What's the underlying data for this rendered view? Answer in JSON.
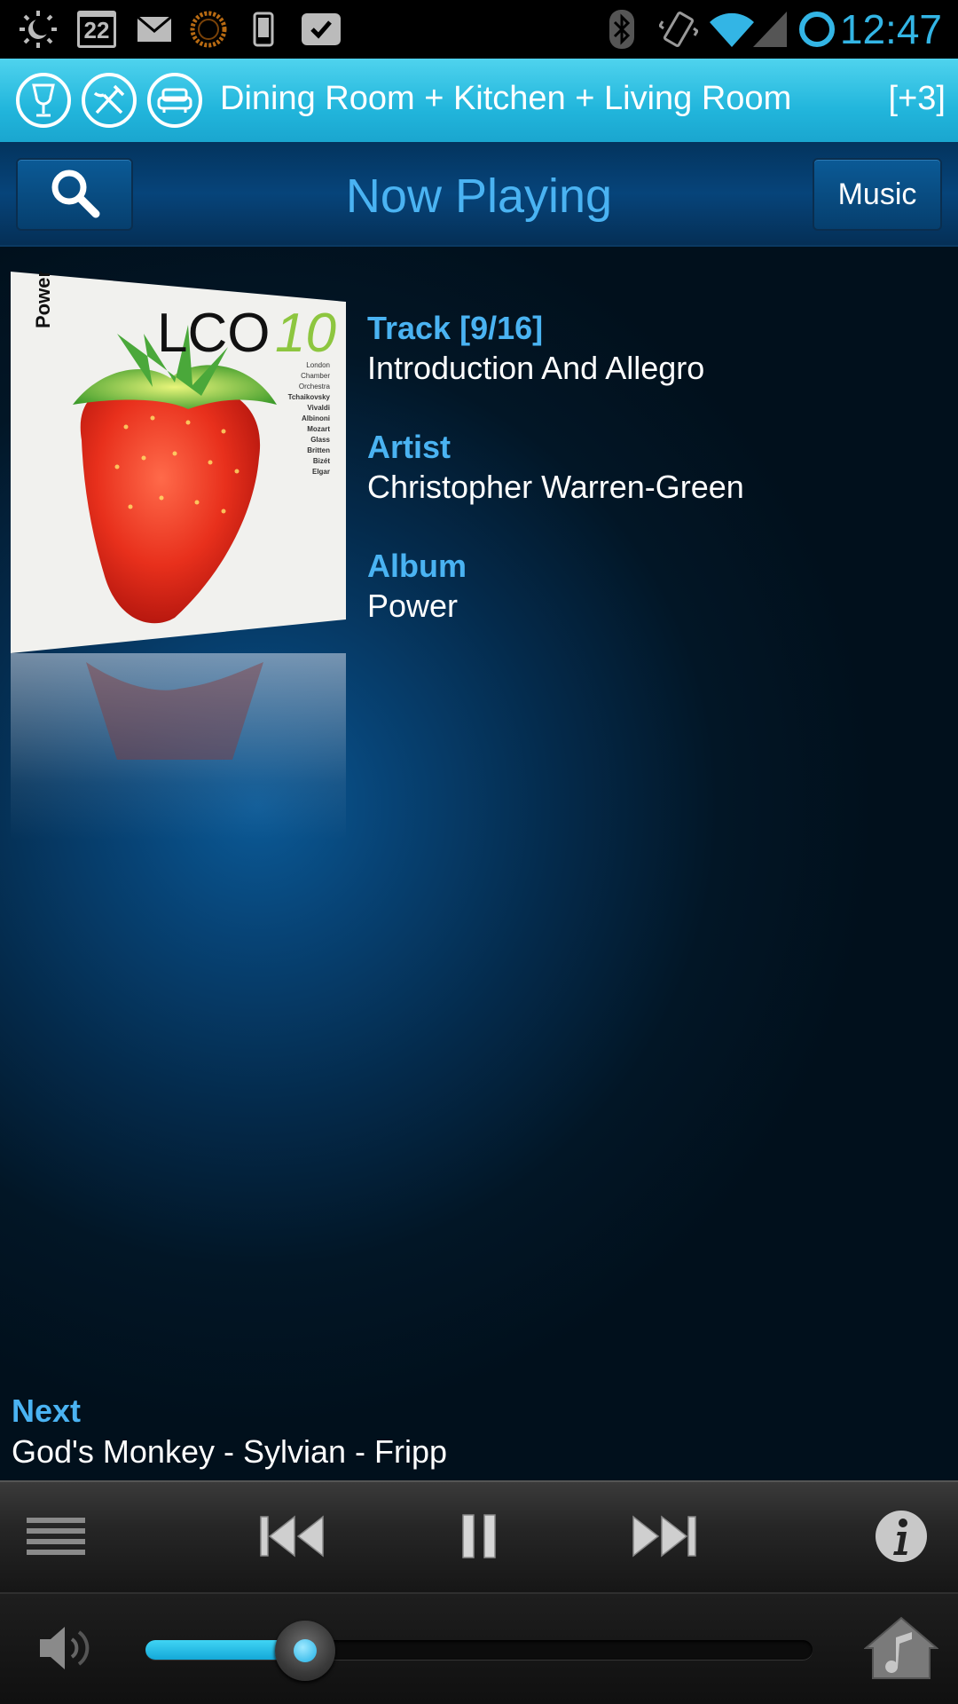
{
  "status_bar": {
    "calendar_date": "22",
    "time": "12:47",
    "icons": [
      "brightness-icon",
      "calendar-icon",
      "mail-icon",
      "sun-app-icon",
      "phone-icon",
      "check-icon",
      "bluetooth-icon",
      "vibrate-icon",
      "wifi-icon",
      "signal-icon",
      "sync-ring-icon"
    ]
  },
  "zone_bar": {
    "title": "Dining Room + Kitchen + Living Room",
    "more": "[+3]",
    "zone_icons": [
      "wine-glass-icon",
      "fork-knife-icon",
      "sofa-icon"
    ]
  },
  "header": {
    "title": "Now Playing",
    "music_label": "Music",
    "search_icon": "search-icon"
  },
  "album_art": {
    "spine_text": "Power",
    "logo_main": "LCO",
    "logo_number": "10",
    "listing": [
      "London",
      "Chamber",
      "Orchestra",
      "Tchaikovsky",
      "Vivaldi",
      "Albinoni",
      "Mozart",
      "Glass",
      "Britten",
      "Bizét",
      "Elgar"
    ]
  },
  "track_info": {
    "track_label": "Track [9/16]",
    "track_title": "Introduction And Allegro",
    "artist_label": "Artist",
    "artist_name": "Christopher Warren-Green",
    "album_label": "Album",
    "album_name": "Power"
  },
  "next": {
    "label": "Next",
    "value": "God's Monkey - Sylvian - Fripp"
  },
  "transport": {
    "icons": [
      "menu-icon",
      "previous-icon",
      "pause-icon",
      "next-icon",
      "info-icon"
    ]
  },
  "volume": {
    "level_percent": 24,
    "icons": [
      "speaker-icon",
      "home-music-icon"
    ]
  },
  "colors": {
    "accent_blue": "#4ab3f2",
    "zone_bar_cyan": "#22b6dc",
    "status_cyan": "#33b5e5"
  }
}
